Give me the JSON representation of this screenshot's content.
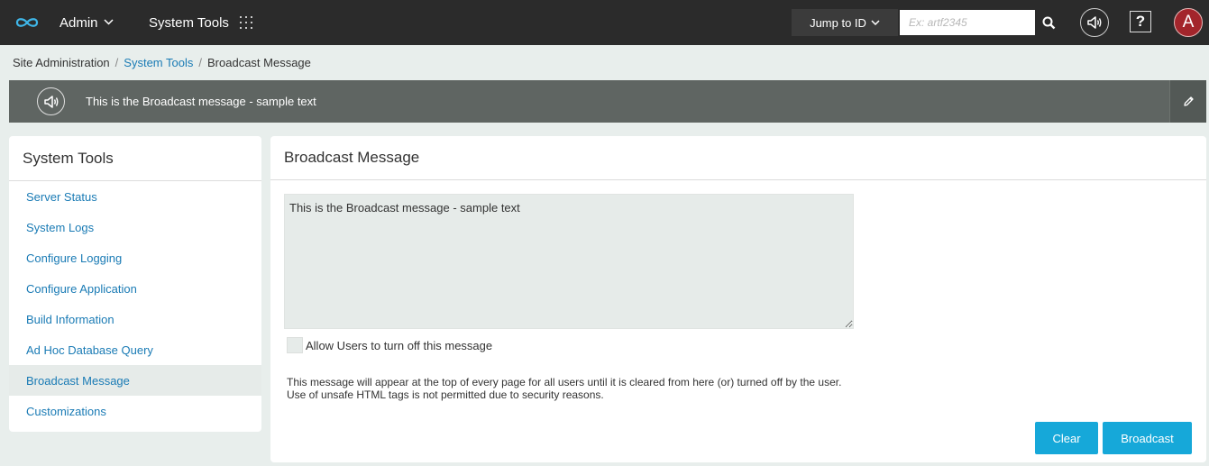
{
  "header": {
    "admin_label": "Admin",
    "tools_label": "System Tools",
    "jump_label": "Jump to ID",
    "jump_placeholder": "Ex: artf2345",
    "avatar_initial": "A",
    "help_label": "?"
  },
  "breadcrumb": {
    "root": "Site Administration",
    "parent": "System Tools",
    "current": "Broadcast Message",
    "separator": "/"
  },
  "banner": {
    "message": "This is the Broadcast message - sample text"
  },
  "sidebar": {
    "title": "System Tools",
    "items": [
      {
        "label": "Server Status"
      },
      {
        "label": "System Logs"
      },
      {
        "label": "Configure Logging"
      },
      {
        "label": "Configure Application"
      },
      {
        "label": "Build Information"
      },
      {
        "label": "Ad Hoc Database Query"
      },
      {
        "label": "Broadcast Message"
      },
      {
        "label": "Customizations"
      }
    ],
    "active_index": 6
  },
  "main": {
    "title": "Broadcast Message",
    "message_value": "This is the Broadcast message - sample text",
    "allow_label": "Allow Users to turn off this message",
    "note_line1": "This message will appear at the top of every page for all users until it is cleared from here (or) turned off by the user.",
    "note_line2": "Use of unsafe HTML tags is not permitted due to security reasons.",
    "clear_label": "Clear",
    "broadcast_label": "Broadcast"
  },
  "colors": {
    "topbar": "#2b2b2b",
    "banner": "#5f6562",
    "link": "#1a7bb5",
    "primary_button": "#16a8d9",
    "avatar": "#a3252b"
  }
}
